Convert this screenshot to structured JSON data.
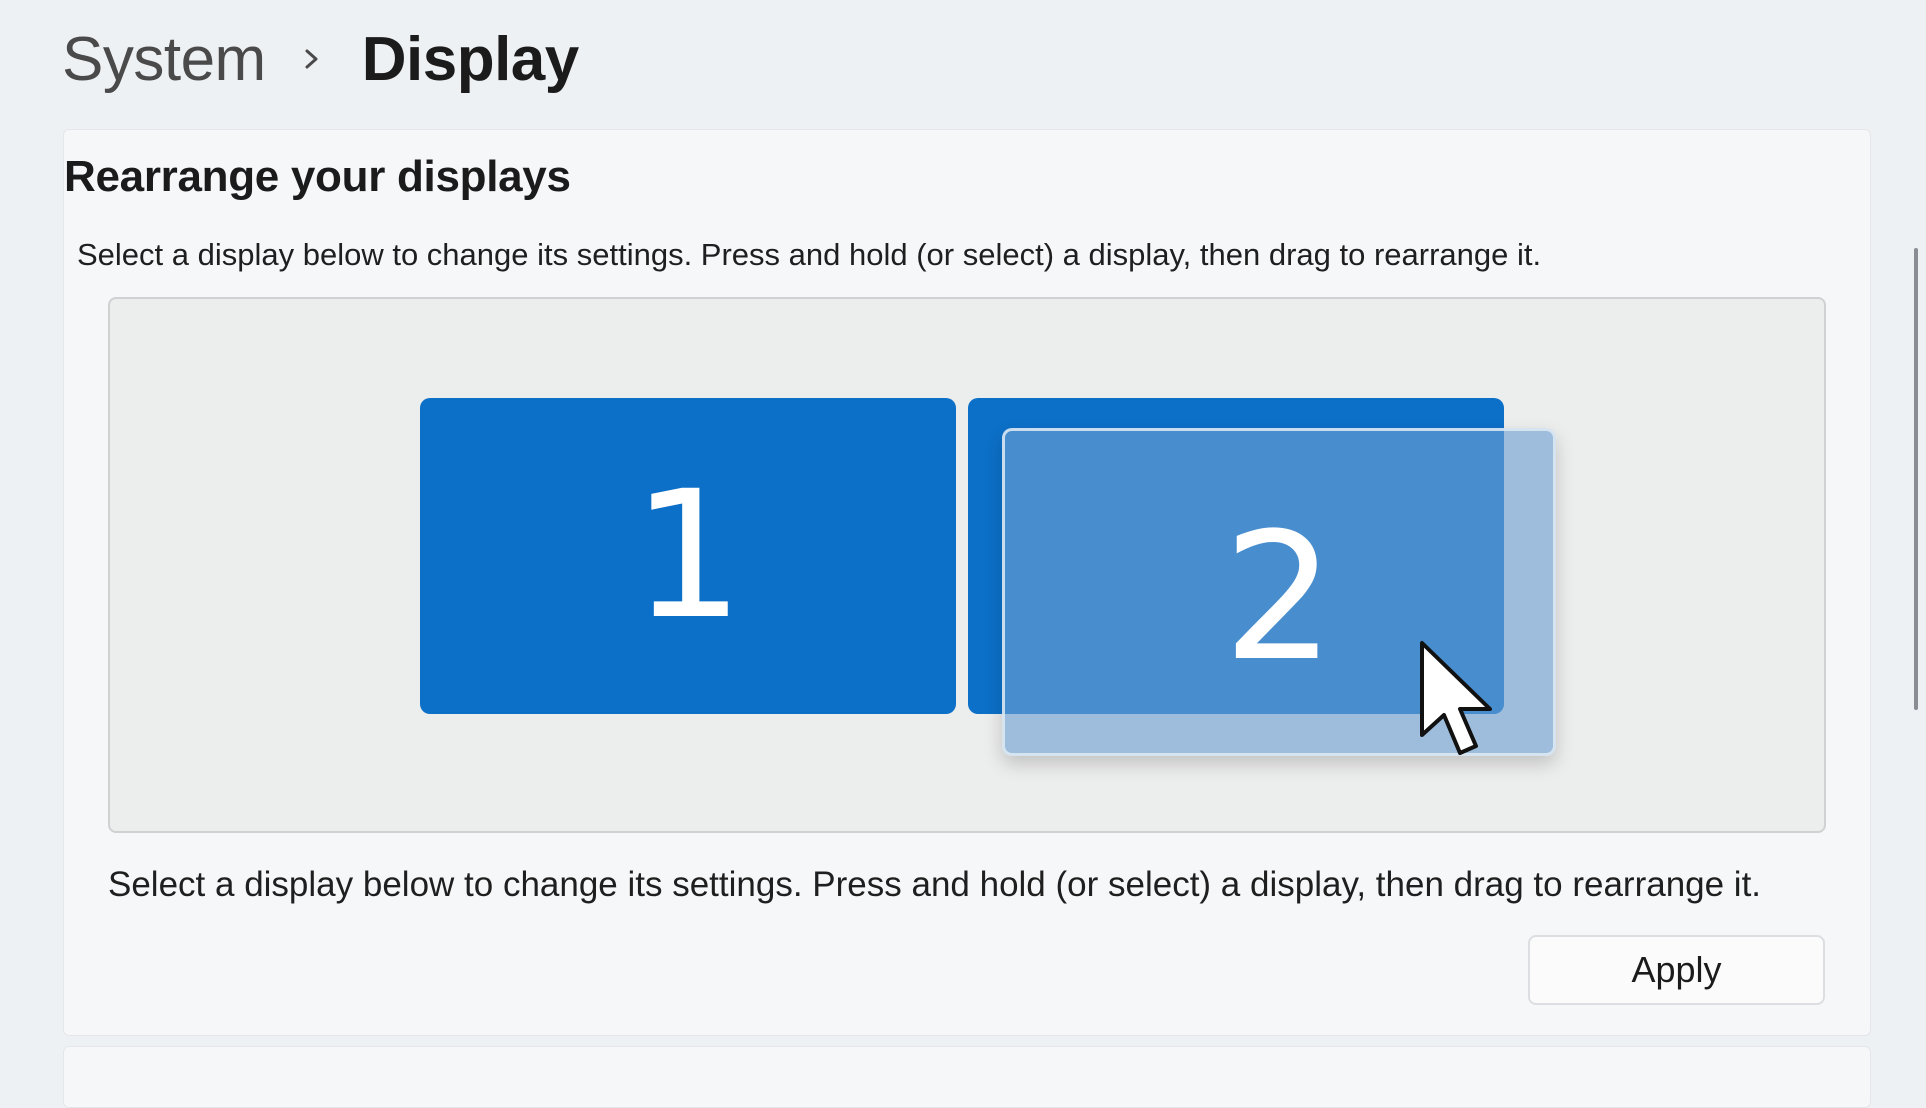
{
  "breadcrumb": {
    "parent": "System",
    "separator_icon": "chevron-right-icon",
    "current": "Display"
  },
  "section": {
    "title": "Rearrange your displays",
    "description_top": "Select a display below to change its settings. Press and hold (or select) a display, then drag to rearrange it.",
    "description_bottom": "Select a display below to change its settings. Press and hold (or select) a display, then drag to rearrange it."
  },
  "displays": [
    {
      "label": "1",
      "state": "static"
    },
    {
      "label": "2",
      "state": "dragging"
    }
  ],
  "cursor_icon": "mouse-pointer-icon",
  "apply_button": {
    "label": "Apply"
  },
  "colors": {
    "accent": "#0c70c8",
    "drag_ghost": "#6ea0d2",
    "page_background": "#eef1f4",
    "card_background": "#f6f7f9",
    "arrange_area_background": "#eceded"
  }
}
